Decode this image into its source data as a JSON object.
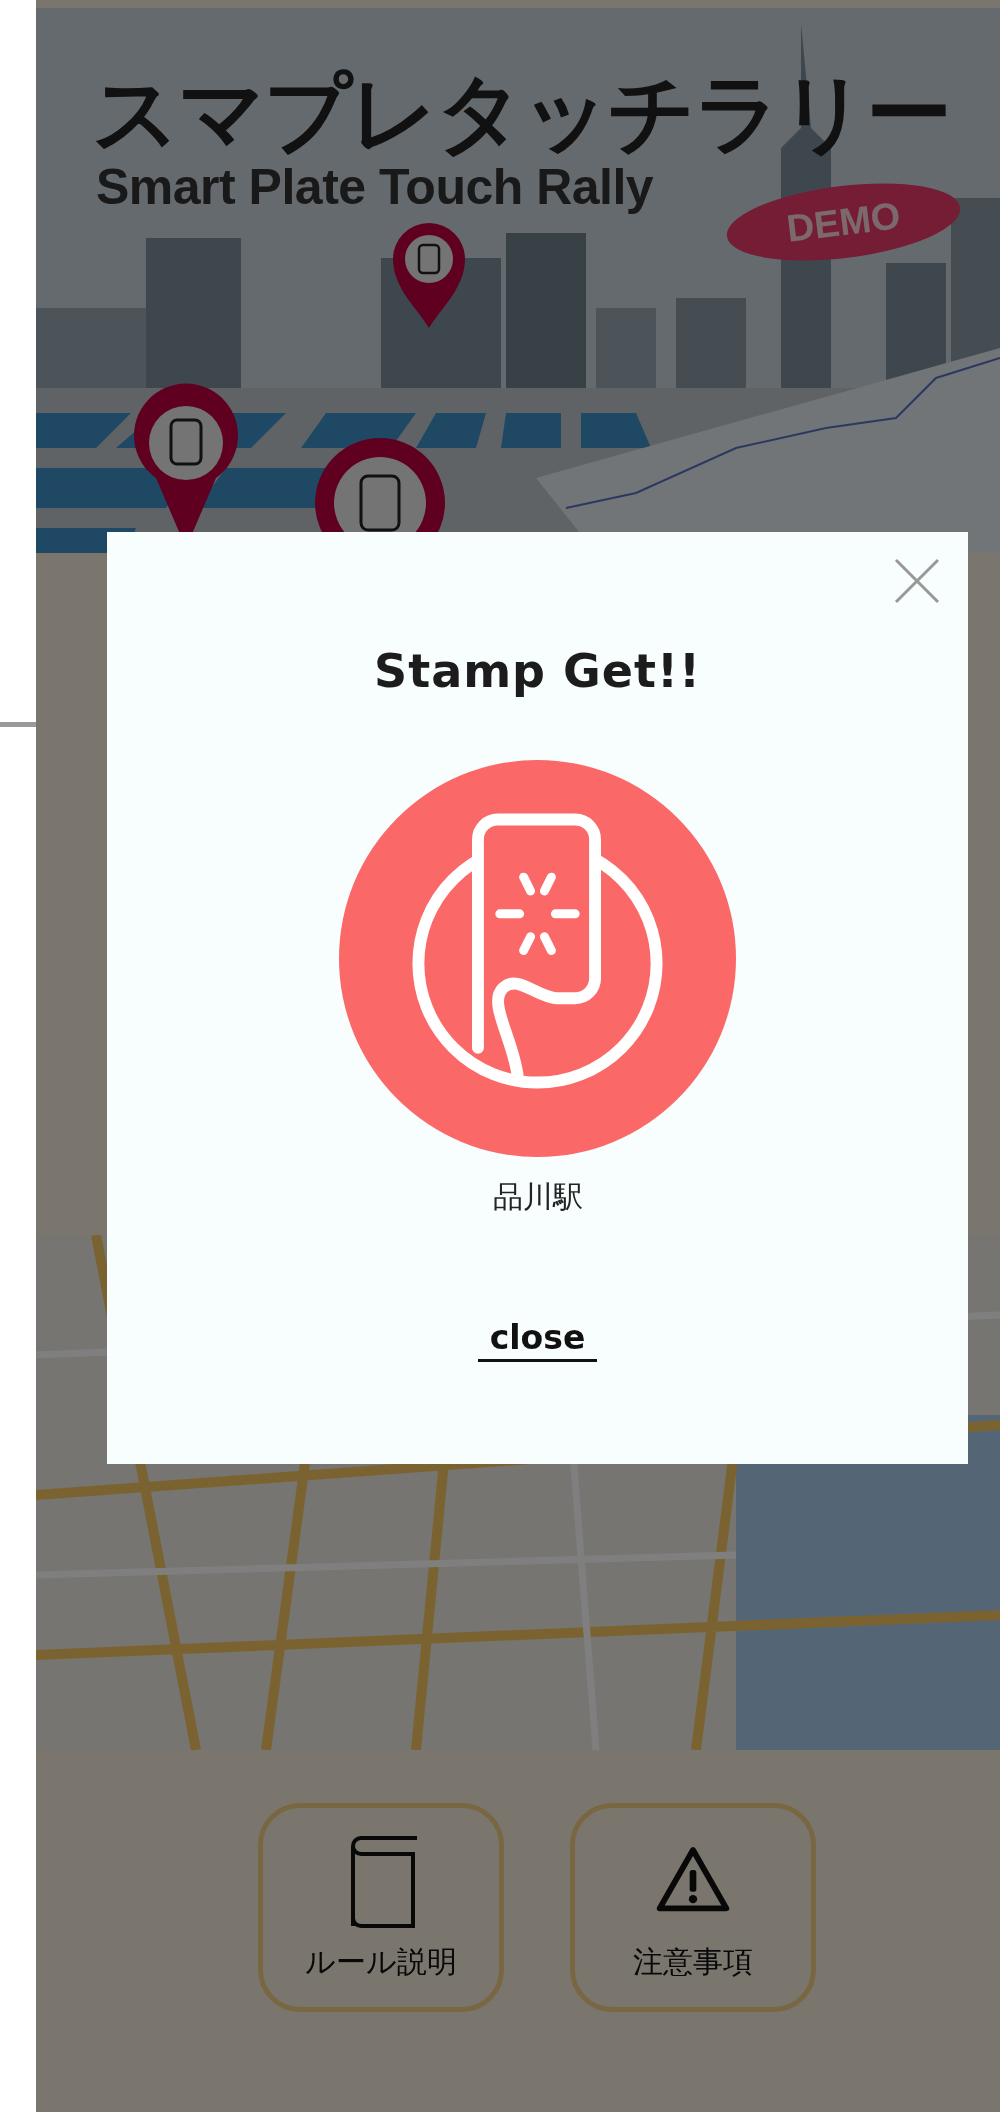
{
  "banner": {
    "title": "スマプレタッチラリー",
    "subtitle": "Smart Plate Touch Rally",
    "badge": "DEMO"
  },
  "modal": {
    "open": true,
    "title": "Stamp Get!!",
    "station": "品川駅",
    "close_link": "close"
  },
  "buttons": [
    {
      "label": "ルール説明",
      "kind": "book"
    },
    {
      "label": "注意事項",
      "kind": "warning"
    }
  ]
}
